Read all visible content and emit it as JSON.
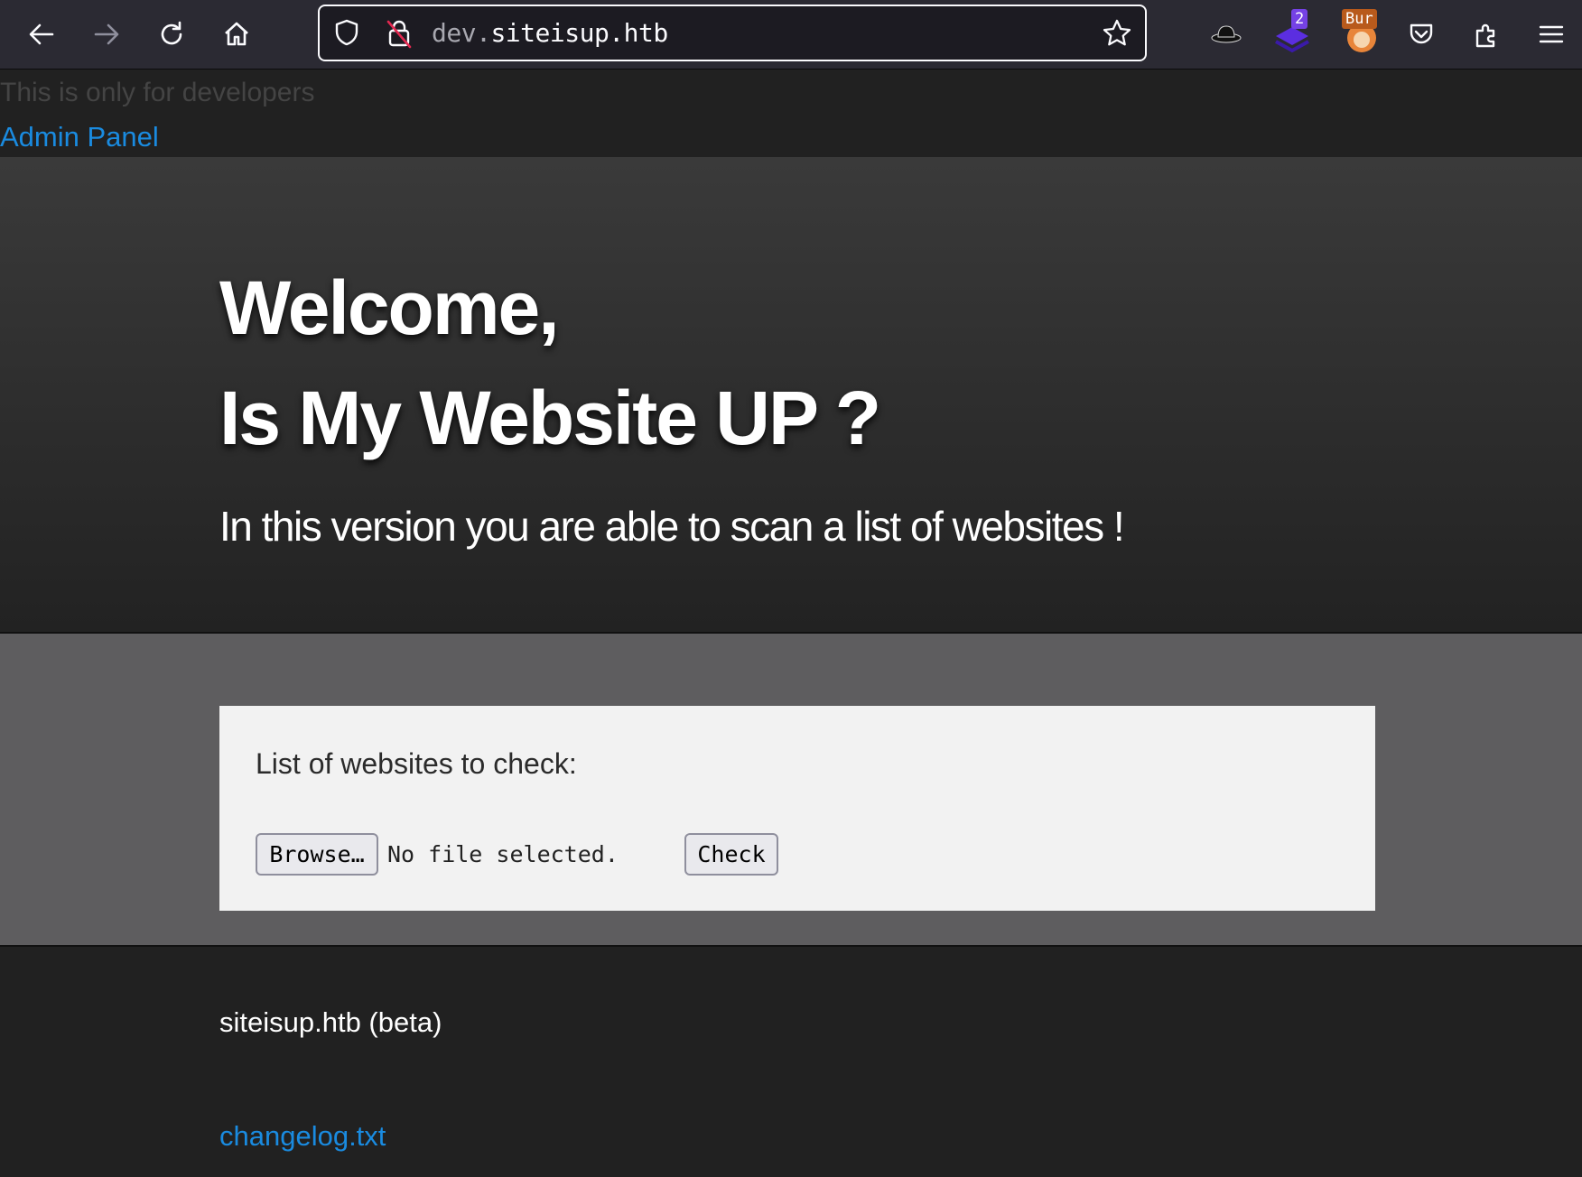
{
  "browser": {
    "url_prefix": "dev.",
    "url_domain": "siteisup.htb",
    "extensions": [
      {
        "name": "hat-extension-icon"
      },
      {
        "name": "layers-extension-icon",
        "badge": "2",
        "badge_color": "#7542e5"
      },
      {
        "name": "burp-extension-icon",
        "badge": "Bur",
        "badge_color": "#b85a1c"
      },
      {
        "name": "pocket-icon"
      },
      {
        "name": "extensions-icon"
      },
      {
        "name": "menu-icon"
      }
    ]
  },
  "page": {
    "dev_note": "This is only for developers",
    "admin_link": "Admin Panel",
    "hero": {
      "line1": "Welcome,",
      "line2": "Is My Website UP ?",
      "subtitle": "In this version you are able to scan a list of websites !"
    },
    "form": {
      "label": "List of websites to check:",
      "browse_label": "Browse…",
      "file_status": "No file selected.",
      "check_label": "Check"
    },
    "footer": {
      "brand": "siteisup.htb (beta)",
      "changelog_link": "changelog.txt"
    }
  },
  "colors": {
    "link": "#1a8be0",
    "page_bg": "#212121",
    "form_section_bg": "#5e5d5f",
    "card_bg": "#f2f2f2"
  }
}
